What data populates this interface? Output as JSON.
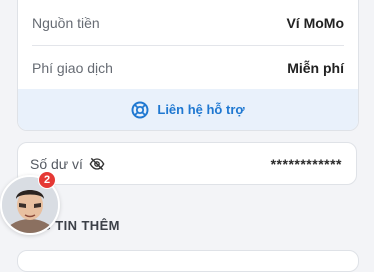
{
  "details": {
    "rows": [
      {
        "label": "Nguồn tiền",
        "value": "Ví MoMo"
      },
      {
        "label": "Phí giao dịch",
        "value": "Miễn phí"
      }
    ],
    "support_label": "Liên hệ hỗ trợ",
    "support_icon": "lifebuoy-icon"
  },
  "balance": {
    "label": "Số dư ví",
    "value": "************",
    "visibility_icon": "eye-slash-icon"
  },
  "section": {
    "heading": "NG TIN THÊM"
  },
  "avatar_bubble": {
    "badge_count": "2"
  },
  "colors": {
    "accent": "#1f78d1",
    "support_bg": "#e9f1fb",
    "badge": "#e53935",
    "page_bg": "#f3f4f7"
  }
}
